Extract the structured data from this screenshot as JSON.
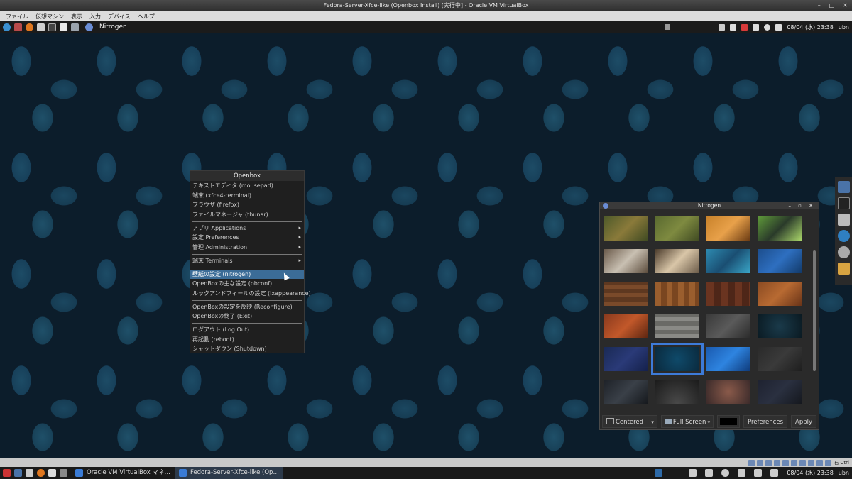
{
  "host": {
    "window_title": "Fedora-Server-Xfce-like (Openbox Install) [実行中] - Oracle VM VirtualBox",
    "window_buttons": [
      "–",
      "□",
      "✕"
    ],
    "menu": [
      "ファイル",
      "仮想マシン",
      "表示",
      "入力",
      "デバイス",
      "ヘルプ"
    ],
    "status_key": "右 Ctrl"
  },
  "guest_panel": {
    "active_task": "Nitrogen",
    "clock": "08/04 (水) 23:38",
    "user": "ubn"
  },
  "openbox_menu": {
    "title": "Openbox",
    "group1": [
      {
        "label": "テキストエディタ (mousepad)"
      },
      {
        "label": "端末 (xfce4-terminal)"
      },
      {
        "label": "ブラウザ (firefox)"
      },
      {
        "label": "ファイルマネージャ (thunar)"
      }
    ],
    "group2": [
      {
        "label": "アプリ Applications",
        "sub": "▸"
      },
      {
        "label": "設定 Preferences",
        "sub": "▸"
      },
      {
        "label": "管理 Administration",
        "sub": "▸"
      }
    ],
    "group3": [
      {
        "label": "端末 Terminals",
        "sub": "▸"
      }
    ],
    "group4": [
      {
        "label": "壁紙の設定 (nitrogen)"
      },
      {
        "label": "OpenBoxの主な設定 (obconf)"
      },
      {
        "label": "ルックアンドフィールの設定 (lxappearance)"
      }
    ],
    "group5": [
      {
        "label": "OpenBoxの設定を反映 (Reconfigure)"
      },
      {
        "label": "OpenBoxの終了 (Exit)"
      }
    ],
    "group6": [
      {
        "label": "ログアウト (Log Out)"
      },
      {
        "label": "再起動 (reboot)"
      },
      {
        "label": "シャットダウン (Shutdown)"
      }
    ]
  },
  "nitrogen": {
    "title": "Nitrogen",
    "title_buttons": "– ▫ ✕",
    "mode": "Centered",
    "display": "Full Screen",
    "dropdown_icon": "▾",
    "preferences_label": "Preferences",
    "apply_label": "Apply",
    "selected_index": 17
  },
  "host_taskbar": {
    "items": [
      "Oracle VM VirtualBox マネ…",
      "Fedora-Server-Xfce-like (Op…"
    ],
    "clock": "08/04 (水) 23:38",
    "user": "ubn"
  }
}
